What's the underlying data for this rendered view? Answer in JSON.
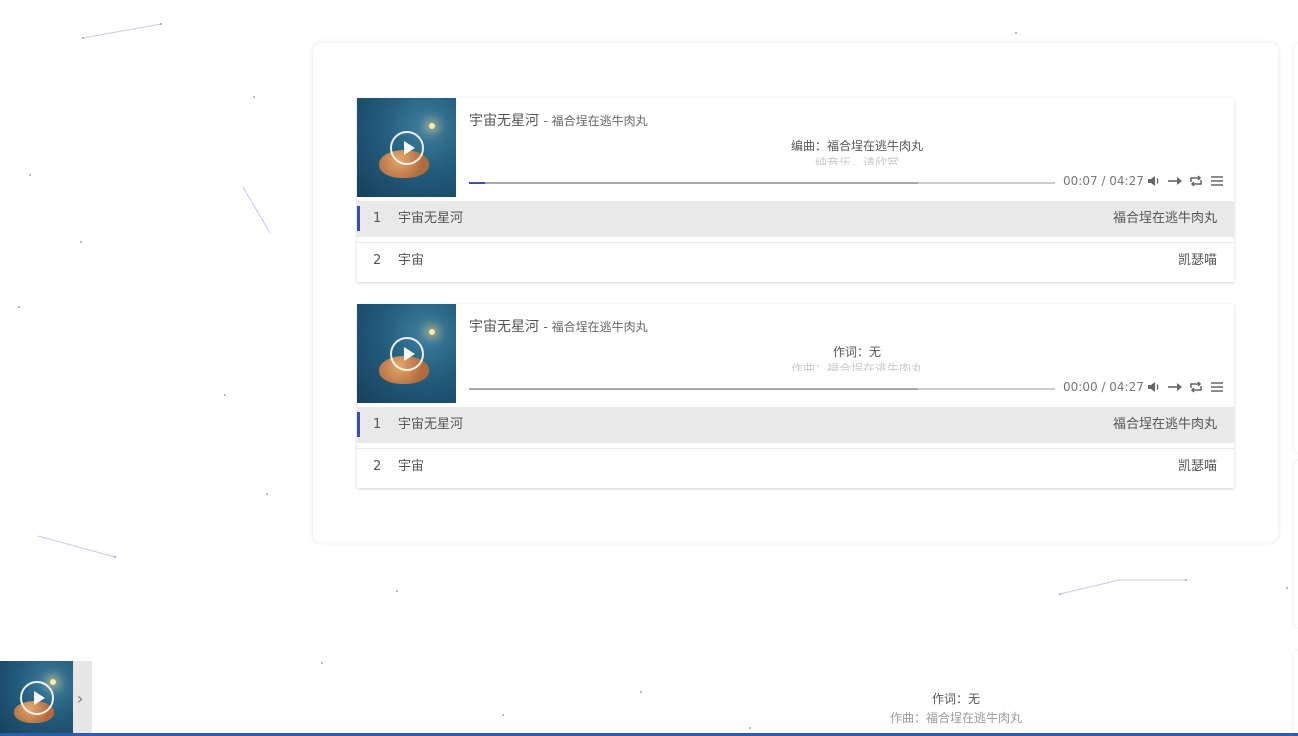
{
  "background": {
    "type": "particle-network",
    "line_color": "#c8c8f0"
  },
  "players": [
    {
      "title": "宇宙无星河",
      "author": "- 福合埕在逃牛肉丸",
      "lrc_current": "编曲：福合埕在逃牛肉丸",
      "lrc_next": "纯音乐，请欣赏",
      "time": "00:07 / 04:27",
      "progress": 0.027,
      "loaded": 0.766,
      "icons": [
        "volume-icon",
        "order-icon",
        "loop-icon",
        "menu-icon"
      ],
      "playlist": [
        {
          "index": "1",
          "name": "宇宙无星河",
          "artist": "福合埕在逃牛肉丸",
          "active": true
        },
        {
          "index": "2",
          "name": "宇宙",
          "artist": "凯瑟喵",
          "active": false
        }
      ]
    },
    {
      "title": "宇宙无星河",
      "author": "- 福合埕在逃牛肉丸",
      "lrc_current": "作词：无",
      "lrc_next": "作曲：福合埕在逃牛肉丸",
      "time": "00:00 / 04:27",
      "progress": 0,
      "loaded": 0.766,
      "icons": [
        "volume-icon",
        "order-icon",
        "loop-icon",
        "menu-icon"
      ],
      "playlist": [
        {
          "index": "1",
          "name": "宇宙无星河",
          "artist": "福合埕在逃牛肉丸",
          "active": true
        },
        {
          "index": "2",
          "name": "宇宙",
          "artist": "凯瑟喵",
          "active": false
        }
      ]
    }
  ],
  "fixed_player": {
    "switch_icon": "chevron-right-icon",
    "switch_glyph": "›",
    "lrc_current": "作词：无",
    "lrc_next": "作曲：福合埕在逃牛肉丸"
  },
  "colors": {
    "accent": "#3b4db3",
    "active_row": "#e9e9e9",
    "bottom_bar": "#2a5ea8"
  }
}
